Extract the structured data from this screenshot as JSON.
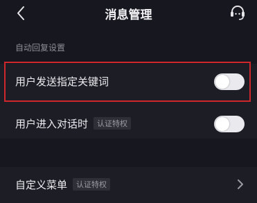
{
  "header": {
    "title": "消息管理",
    "back_icon": "chevron-left-icon",
    "service_icon": "headset-icon"
  },
  "section": {
    "label": "自动回复设置"
  },
  "rows": [
    {
      "label": "用户发送指定关键词",
      "toggle_on": false
    },
    {
      "label": "用户进入对话时",
      "badge": "认证特权",
      "toggle_on": false
    },
    {
      "label": "自定义菜单",
      "badge": "认证特权"
    }
  ],
  "colors": {
    "background": "#17171f",
    "highlight_border": "#d0272d",
    "toggle_off": "#e9e9ee"
  }
}
